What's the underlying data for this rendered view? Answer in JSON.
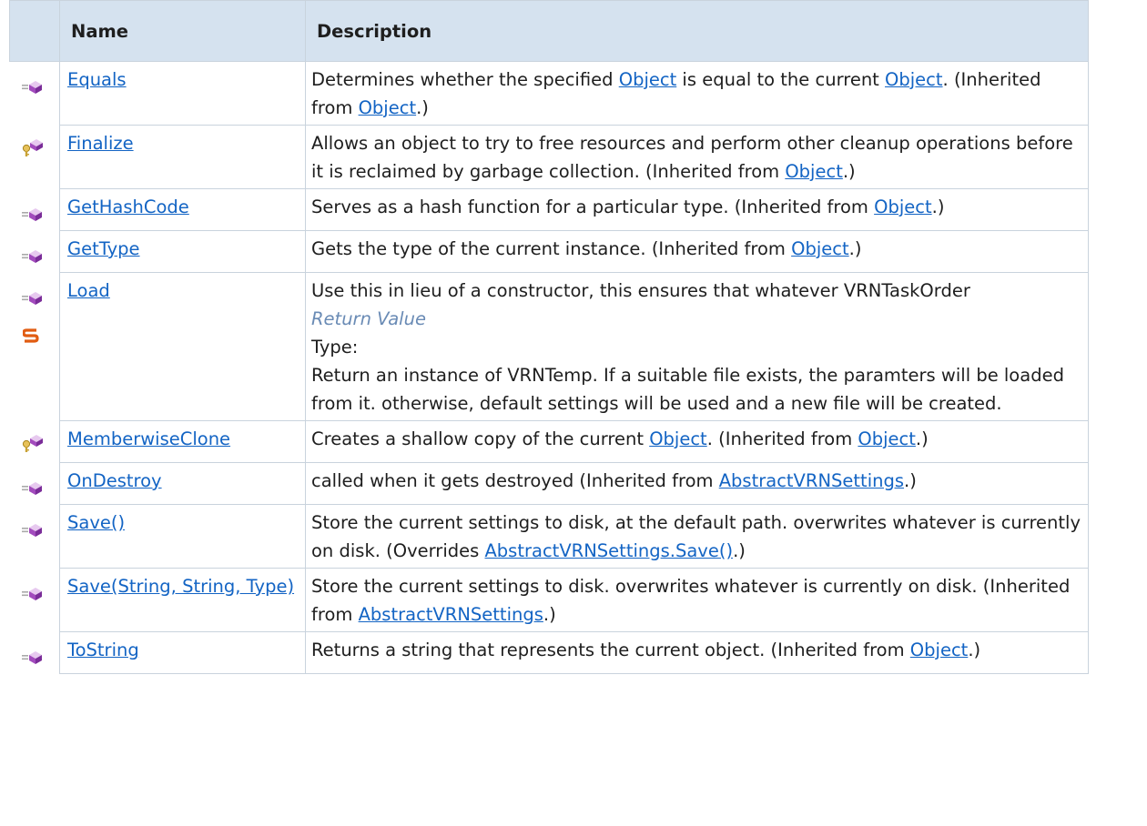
{
  "header": {
    "name": "Name",
    "description": "Description"
  },
  "rows": [
    {
      "name": "Equals",
      "icon": "public-method-icon",
      "desc": [
        "Determines whether the specified ",
        {
          "link": "Object"
        },
        " is equal to the current ",
        {
          "link": "Object"
        },
        ". (Inherited from ",
        {
          "link": "Object"
        },
        ".)"
      ]
    },
    {
      "name": "Finalize",
      "icon": "protected-method-icon",
      "desc": [
        "Allows an object to try to free resources and perform other cleanup operations before it is reclaimed by garbage collection. (Inherited from ",
        {
          "link": "Object"
        },
        ".)"
      ]
    },
    {
      "name": "GetHashCode",
      "icon": "public-method-icon",
      "desc": [
        "Serves as a hash function for a particular type. (Inherited from ",
        {
          "link": "Object"
        },
        ".)"
      ]
    },
    {
      "name": "GetType",
      "icon": "public-method-icon",
      "desc": [
        "Gets the type of the current instance. (Inherited from ",
        {
          "link": "Object"
        },
        ".)"
      ]
    },
    {
      "name": "Load",
      "icon": "public-method-icon",
      "static": true,
      "desc_block": {
        "line1": "Use this in lieu of a constructor, this ensures that whatever VRNTaskOrder",
        "caption": "Return Value",
        "type_label": "Type:",
        "text": "Return an instance of VRNTemp. If a suitable file exists, the paramters will be loaded from it. otherwise, default settings will be used and a new file will be created."
      }
    },
    {
      "name": "MemberwiseClone",
      "icon": "protected-method-icon",
      "desc": [
        "Creates a shallow copy of the current ",
        {
          "link": "Object"
        },
        ". (Inherited from ",
        {
          "link": "Object"
        },
        ".)"
      ]
    },
    {
      "name": "OnDestroy",
      "icon": "public-method-icon",
      "desc": [
        "called when it gets destroyed (Inherited from ",
        {
          "link": "AbstractVRNSettings"
        },
        ".)"
      ]
    },
    {
      "name": "Save()",
      "icon": "public-method-icon",
      "desc": [
        "Store the current settings to disk, at the default path. overwrites whatever is currently on disk. (Overrides ",
        {
          "link": "AbstractVRNSettings.Save()"
        },
        ".)"
      ]
    },
    {
      "name": "Save(String, String, Type)",
      "icon": "public-method-icon",
      "desc": [
        "Store the current settings to disk. overwrites whatever is currently on disk. (Inherited from ",
        {
          "link": "AbstractVRNSettings"
        },
        ".)"
      ]
    },
    {
      "name": "ToString",
      "icon": "public-method-icon",
      "desc": [
        "Returns a string that represents the current object. (Inherited from ",
        {
          "link": "Object"
        },
        ".)"
      ]
    }
  ]
}
